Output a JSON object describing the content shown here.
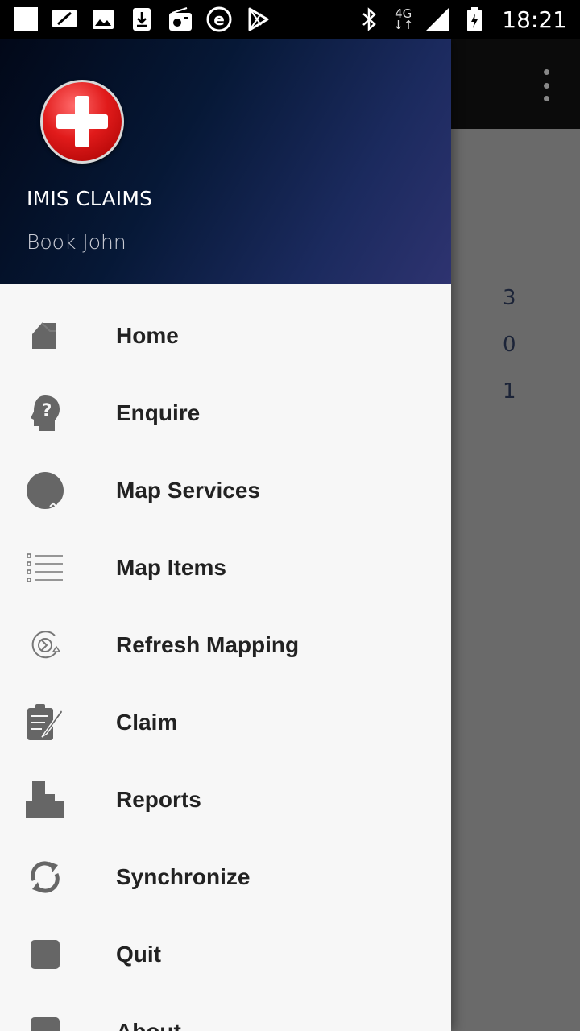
{
  "status_bar": {
    "network": "4G",
    "time": "18:21",
    "notification_icons": [
      "blank-square-icon",
      "screen-icon",
      "image-icon",
      "download-icon",
      "radio-icon",
      "e-app-icon",
      "play-store-icon"
    ],
    "system_icons": [
      "bluetooth-icon",
      "signal-icon",
      "battery-icon"
    ]
  },
  "drawer": {
    "header": {
      "app_name": "IMIS CLAIMS",
      "user_name": "Book John"
    },
    "items": [
      {
        "label": "Home",
        "icon": "home-icon"
      },
      {
        "label": "Enquire",
        "icon": "enquire-icon"
      },
      {
        "label": "Map Services",
        "icon": "map-services-icon"
      },
      {
        "label": "Map Items",
        "icon": "list-icon"
      },
      {
        "label": "Refresh Mapping",
        "icon": "refresh-mapping-icon"
      },
      {
        "label": "Claim",
        "icon": "claim-icon"
      },
      {
        "label": "Reports",
        "icon": "reports-icon"
      },
      {
        "label": "Synchronize",
        "icon": "sync-icon"
      },
      {
        "label": "Quit",
        "icon": "quit-icon"
      },
      {
        "label": "About",
        "icon": "about-icon"
      }
    ]
  },
  "background": {
    "counts": [
      "3",
      "0",
      "1"
    ]
  },
  "colors": {
    "header_gradient_start": "#020818",
    "header_gradient_end": "#2e3370",
    "logo_red": "#e11b1b",
    "drawer_bg": "#f7f7f7",
    "scrim": "#6a6a6a",
    "icon_gray": "#666666"
  }
}
